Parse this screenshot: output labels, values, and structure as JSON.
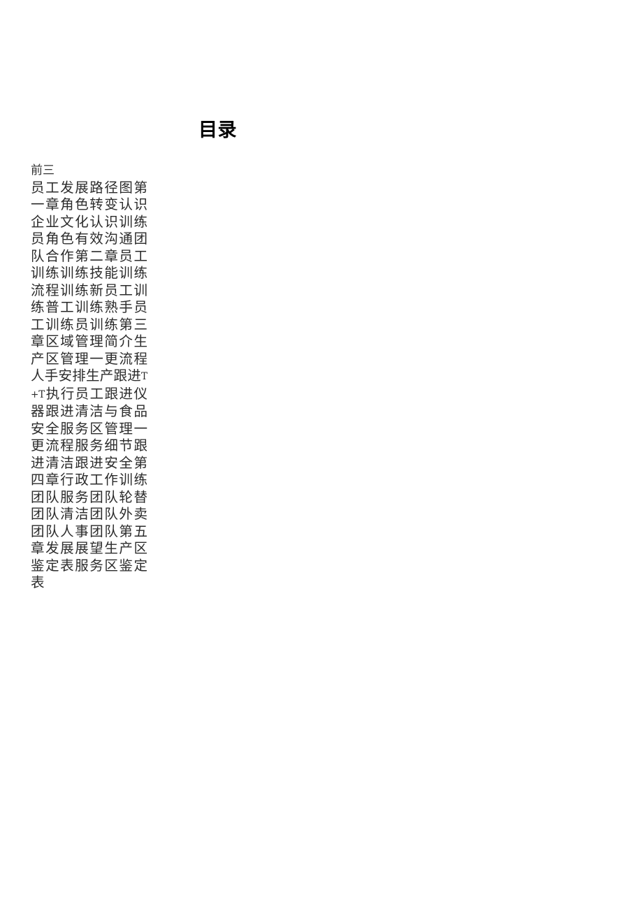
{
  "document": {
    "title": "目录",
    "page_background": "#ffffff",
    "text_color": "#2b2b2b",
    "title_color": "#000000"
  },
  "toc": {
    "preface_line": "前三",
    "entries_text_part1": "员工发展路径图第一章角色转变认识企业文化认识训练员角色有效沟通团队合作第二章员工训练训练技能训练流程训练新员工训练普工训练熟手员工训练员训练第三章区域管理简介生产区管理一更流程人手安排生产跟进",
    "entries_latin": "T+T",
    "entries_text_part2": "执行员工跟进仪器跟进清洁与食品安全服务区管理一更流程服务细节跟进清洁跟进安全第四章行政工作训练团队服务团队轮替团队清洁团队外卖团队人事团队第五章发展展望生产区鉴定表服务区鉴定表",
    "entry_list": [
      "前三",
      "员工发展路径图",
      "第一章角色转变认识",
      "企业文化认识",
      "训练员角色",
      "有效沟通",
      "团队合作",
      "第二章员工训练",
      "训练技能训练",
      "流程训练",
      "新员工训练",
      "普工训练",
      "熟手员工训练",
      "训练员训练",
      "第三章区域管理简介",
      "生产区管理",
      "一更流程",
      "人手安排",
      "生产跟进",
      "T+T执行",
      "员工跟进",
      "仪器跟进",
      "清洁与食品安全",
      "服务区管理",
      "一更流程",
      "服务细节跟进",
      "清洁跟进",
      "安全",
      "第四章行政工作训练",
      "团队服务",
      "团队轮替",
      "团队清洁",
      "团队外卖",
      "团队人事",
      "团队",
      "第五章发展展望",
      "生产区鉴定表",
      "服务区鉴定表"
    ]
  }
}
